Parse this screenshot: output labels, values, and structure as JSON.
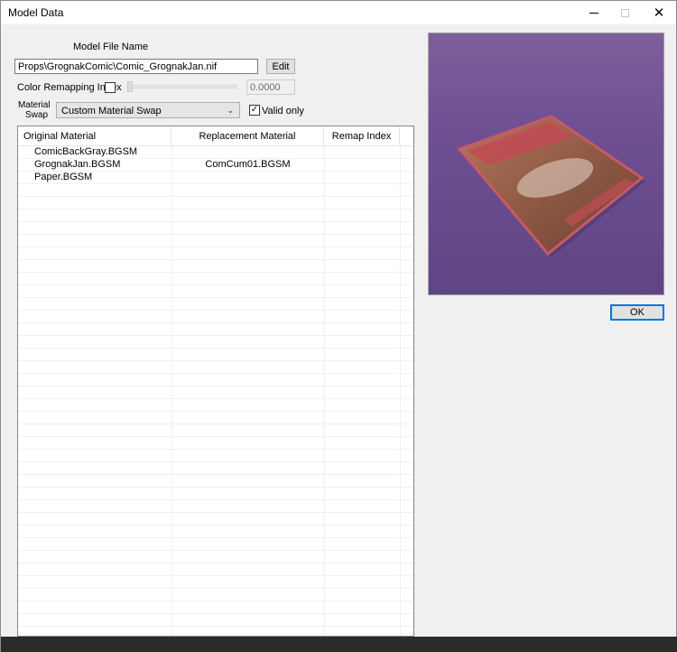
{
  "window": {
    "title": "Model Data",
    "close_glyph": "✕"
  },
  "model_file": {
    "label": "Model File Name",
    "value": "Props\\GrognakComic\\Comic_GrognakJan.nif",
    "edit_label": "Edit"
  },
  "color_remap": {
    "label": "Color Remapping Index",
    "checked": false,
    "value": "0.0000"
  },
  "material_swap": {
    "label_line1": "Material",
    "label_line2": "Swap",
    "selected": "Custom Material Swap",
    "valid_only_label": "Valid only",
    "valid_only_checked": true,
    "check_glyph": "✓"
  },
  "materials_table": {
    "columns": [
      "Original Material",
      "Replacement Material",
      "Remap Index"
    ],
    "rows": [
      {
        "original": "ComicBackGray.BGSM",
        "replacement": "",
        "remap": ""
      },
      {
        "original": "GrognakJan.BGSM",
        "replacement": "ComCum01.BGSM",
        "remap": ""
      },
      {
        "original": "Paper.BGSM",
        "replacement": "",
        "remap": ""
      }
    ]
  },
  "ok_label": "OK",
  "colors": {
    "preview_bg": "#6e4f92",
    "accent": "#0078d7"
  }
}
